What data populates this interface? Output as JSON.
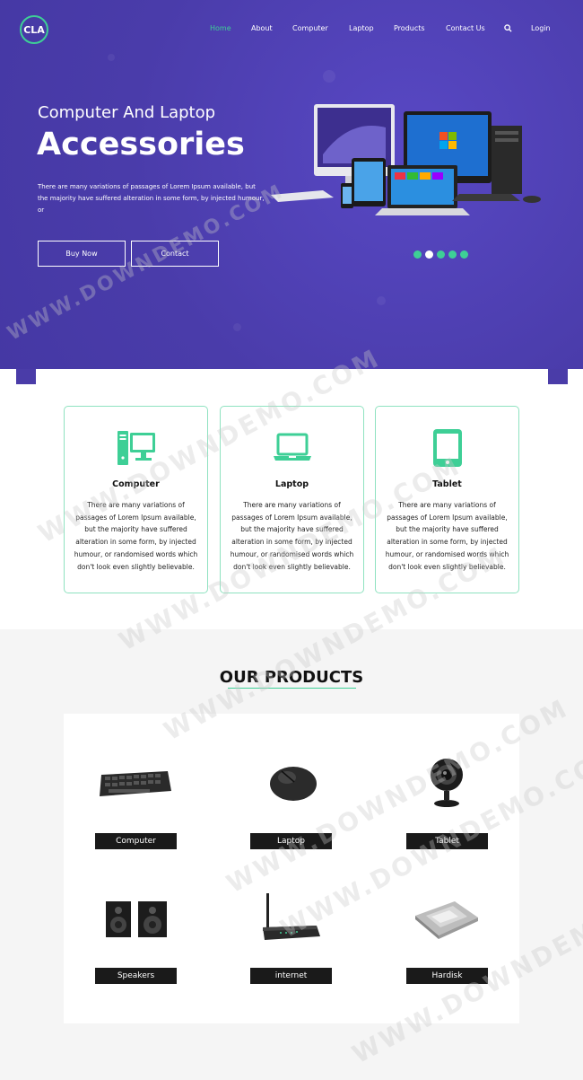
{
  "brand": {
    "logo_text": "CLA"
  },
  "nav": {
    "items": [
      {
        "label": "Home",
        "active": true
      },
      {
        "label": "About"
      },
      {
        "label": "Computer"
      },
      {
        "label": "Laptop"
      },
      {
        "label": "Products"
      },
      {
        "label": "Contact Us"
      }
    ],
    "search_icon": "search-icon",
    "login_label": "Login"
  },
  "hero": {
    "subtitle": "Computer And Laptop",
    "title": "Accessories",
    "text": "There are many variations of passages of Lorem Ipsum available, but the majority have suffered alteration in some form, by injected humour, or",
    "buy_label": "Buy Now",
    "contact_label": "Contact",
    "slides": 5,
    "active_slide": 2
  },
  "features": [
    {
      "icon": "desktop-computer-icon",
      "title": "Computer",
      "text": "There are many variations of passages of Lorem Ipsum available, but the majority have suffered alteration in some form, by injected humour, or randomised words which don't look even slightly believable."
    },
    {
      "icon": "laptop-icon",
      "title": "Laptop",
      "text": "There are many variations of passages of Lorem Ipsum available, but the majority have suffered alteration in some form, by injected humour, or randomised words which don't look even slightly believable."
    },
    {
      "icon": "tablet-icon",
      "title": "Tablet",
      "text": "There are many variations of passages of Lorem Ipsum available, but the majority have suffered alteration in some form, by injected humour, or randomised words which don't look even slightly believable."
    }
  ],
  "products": {
    "heading": "OUR PRODUCTS",
    "items": [
      {
        "label": "Computer",
        "icon": "keyboard-icon"
      },
      {
        "label": "Laptop",
        "icon": "mouse-icon"
      },
      {
        "label": "Tablet",
        "icon": "webcam-icon"
      },
      {
        "label": "Speakers",
        "icon": "speakers-icon"
      },
      {
        "label": "internet",
        "icon": "router-icon"
      },
      {
        "label": "Hardisk",
        "icon": "hard-disk-icon"
      }
    ]
  },
  "watermark": "WWW.DOWNDEMO.COM",
  "colors": {
    "hero_bg": "#4d3fb0",
    "accent": "#3ecf96",
    "dark": "#1a1a1a"
  }
}
